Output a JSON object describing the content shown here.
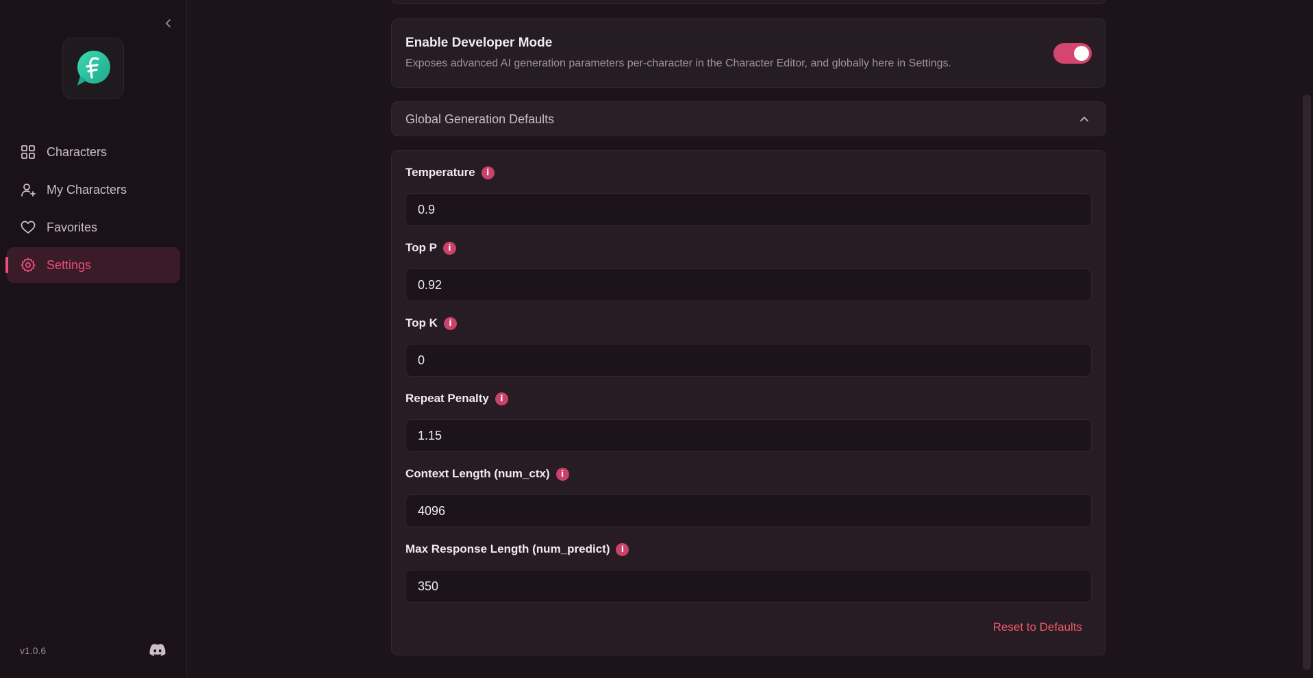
{
  "app": {
    "version": "v1.0.6"
  },
  "sidebar": {
    "items": [
      {
        "label": "Characters",
        "icon": "grid-icon"
      },
      {
        "label": "My Characters",
        "icon": "user-plus-icon"
      },
      {
        "label": "Favorites",
        "icon": "heart-icon"
      },
      {
        "label": "Settings",
        "icon": "gear-icon",
        "active": true
      }
    ]
  },
  "developer_mode": {
    "title": "Enable Developer Mode",
    "description": "Exposes advanced AI generation parameters per-character in the Character Editor, and globally here in Settings.",
    "enabled": true
  },
  "global_defaults": {
    "title": "Global Generation Defaults",
    "expanded": true,
    "fields": [
      {
        "label": "Temperature",
        "value": "0.9"
      },
      {
        "label": "Top P",
        "value": "0.92"
      },
      {
        "label": "Top K",
        "value": "0"
      },
      {
        "label": "Repeat Penalty",
        "value": "1.15"
      },
      {
        "label": "Context Length (num_ctx)",
        "value": "4096"
      },
      {
        "label": "Max Response Length (num_predict)",
        "value": "350"
      }
    ],
    "reset_label": "Reset to Defaults"
  },
  "colors": {
    "accent": "#ee4d7d",
    "toggle_on": "#d4456f",
    "reset": "#ee5a6c",
    "logo": "#2bc4a0"
  }
}
